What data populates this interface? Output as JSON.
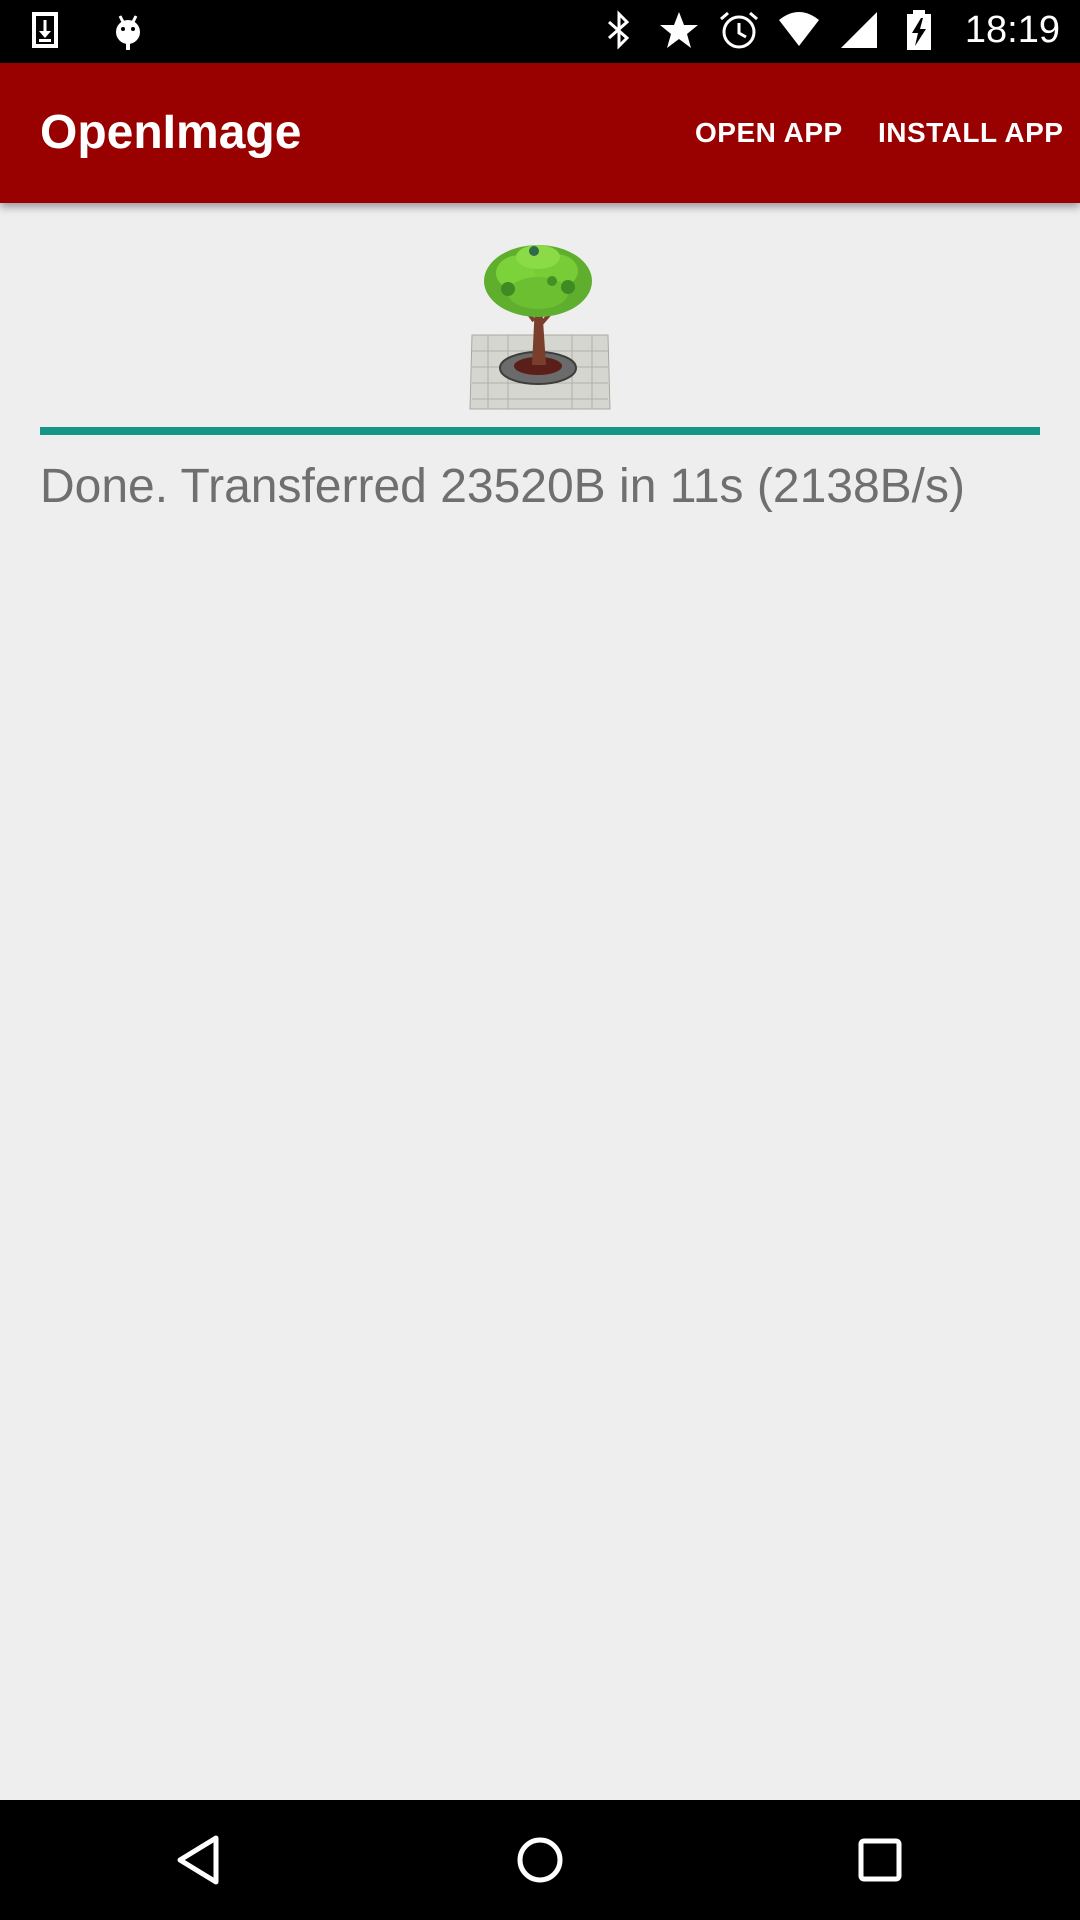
{
  "status_bar": {
    "time": "18:19",
    "left_icons": [
      "download-icon",
      "android-debug-icon"
    ],
    "right_icons": [
      "bluetooth-icon",
      "star-icon",
      "alarm-icon",
      "wifi-icon",
      "signal-icon",
      "battery-charging-icon"
    ]
  },
  "app_bar": {
    "title": "OpenImage",
    "actions": [
      "OPEN APP",
      "INSTALL APP"
    ],
    "color": "#990000"
  },
  "main": {
    "image": "tree-image",
    "progress": 1.0,
    "progress_color": "#159586",
    "status": "Done. Transferred 23520B in 11s (2138B/s)"
  },
  "nav_bar": {
    "buttons": [
      "back-icon",
      "home-icon",
      "recent-apps-icon"
    ]
  }
}
